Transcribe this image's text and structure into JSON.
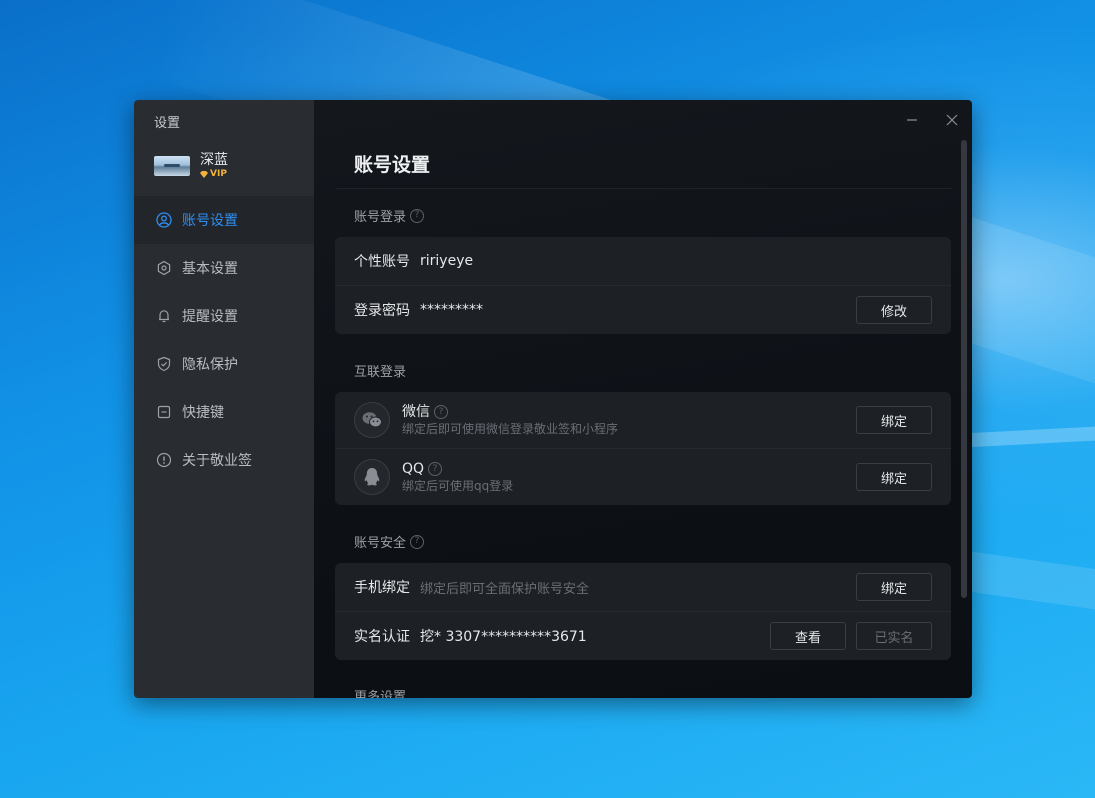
{
  "window": {
    "title": "设置"
  },
  "profile": {
    "name": "深蓝",
    "badge": "VIP"
  },
  "sidebar": {
    "items": [
      {
        "label": "账号设置",
        "icon": "user-circle-icon",
        "active": true
      },
      {
        "label": "基本设置",
        "icon": "gear-icon"
      },
      {
        "label": "提醒设置",
        "icon": "bell-icon"
      },
      {
        "label": "隐私保护",
        "icon": "shield-icon"
      },
      {
        "label": "快捷键",
        "icon": "keyboard-icon"
      },
      {
        "label": "关于敬业签",
        "icon": "info-icon"
      }
    ]
  },
  "main": {
    "title": "账号设置",
    "account_login": {
      "label": "账号登录",
      "username_label": "个性账号",
      "username_value": "ririyeye",
      "password_label": "登录密码",
      "password_value": "*********",
      "modify_button": "修改"
    },
    "linked_login": {
      "label": "互联登录",
      "wechat": {
        "name": "微信",
        "desc": "绑定后即可使用微信登录敬业签和小程序",
        "button": "绑定"
      },
      "qq": {
        "name": "QQ",
        "desc": "绑定后可使用qq登录",
        "button": "绑定"
      }
    },
    "security": {
      "label": "账号安全",
      "phone_label": "手机绑定",
      "phone_hint": "绑定后即可全面保护账号安全",
      "phone_button": "绑定",
      "realname_label": "实名认证",
      "realname_value": "挖* 3307**********3671",
      "view_button": "查看",
      "verified_button": "已实名"
    },
    "more_label": "更多设置"
  },
  "colors": {
    "accent": "#2f8ff0",
    "vip": "#f2b33d",
    "sidebar_bg": "#292c31",
    "main_bg": "#0f1318",
    "card_bg": "#1d2024"
  }
}
